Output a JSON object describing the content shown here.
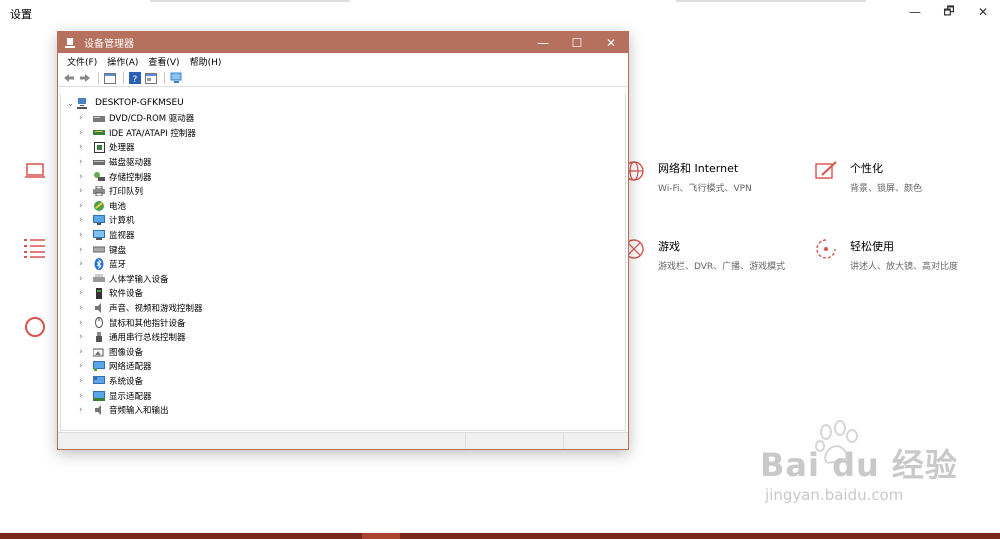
{
  "settings": {
    "title": "设置",
    "window_controls": {
      "minimize": "—",
      "maximize": "🗗",
      "close": "✕"
    },
    "tiles": [
      {
        "name": "网络和 Internet",
        "desc": "Wi-Fi、飞行模式、VPN",
        "icon": "globe-icon"
      },
      {
        "name": "个性化",
        "desc": "背景、锁屏、颜色",
        "icon": "paint-icon"
      },
      {
        "name": "游戏",
        "desc": "游戏栏、DVR、广播、游戏模式",
        "icon": "xbox-icon"
      },
      {
        "name": "轻松使用",
        "desc": "讲述人、放大镜、高对比度",
        "icon": "ease-of-access-icon"
      }
    ],
    "accent": "#d9534f"
  },
  "device_manager": {
    "title": "设备管理器",
    "controls": {
      "minimize": "—",
      "maximize": "☐",
      "close": "✕"
    },
    "menu": [
      "文件(F)",
      "操作(A)",
      "查看(V)",
      "帮助(H)"
    ],
    "root": "DESKTOP-GFKMSEU",
    "items": [
      {
        "label": "DVD/CD-ROM 驱动器",
        "icon": "dvd-drive-icon"
      },
      {
        "label": "IDE ATA/ATAPI 控制器",
        "icon": "ide-controller-icon"
      },
      {
        "label": "处理器",
        "icon": "processor-icon"
      },
      {
        "label": "磁盘驱动器",
        "icon": "disk-drive-icon"
      },
      {
        "label": "存储控制器",
        "icon": "storage-controller-icon"
      },
      {
        "label": "打印队列",
        "icon": "printer-icon"
      },
      {
        "label": "电池",
        "icon": "battery-icon"
      },
      {
        "label": "计算机",
        "icon": "computer-icon"
      },
      {
        "label": "监视器",
        "icon": "monitor-icon"
      },
      {
        "label": "键盘",
        "icon": "keyboard-icon"
      },
      {
        "label": "蓝牙",
        "icon": "bluetooth-icon"
      },
      {
        "label": "人体学输入设备",
        "icon": "hid-icon"
      },
      {
        "label": "软件设备",
        "icon": "software-device-icon"
      },
      {
        "label": "声音、视频和游戏控制器",
        "icon": "sound-icon"
      },
      {
        "label": "鼠标和其他指针设备",
        "icon": "mouse-icon"
      },
      {
        "label": "通用串行总线控制器",
        "icon": "usb-icon"
      },
      {
        "label": "图像设备",
        "icon": "camera-icon"
      },
      {
        "label": "网络适配器",
        "icon": "network-adapter-icon"
      },
      {
        "label": "系统设备",
        "icon": "system-device-icon"
      },
      {
        "label": "显示适配器",
        "icon": "display-adapter-icon"
      },
      {
        "label": "音频输入和输出",
        "icon": "audio-io-icon"
      }
    ],
    "title_color": "#b5705e"
  },
  "watermark": {
    "brand": "Bai du 经验",
    "url": "jingyan.baidu.com"
  }
}
